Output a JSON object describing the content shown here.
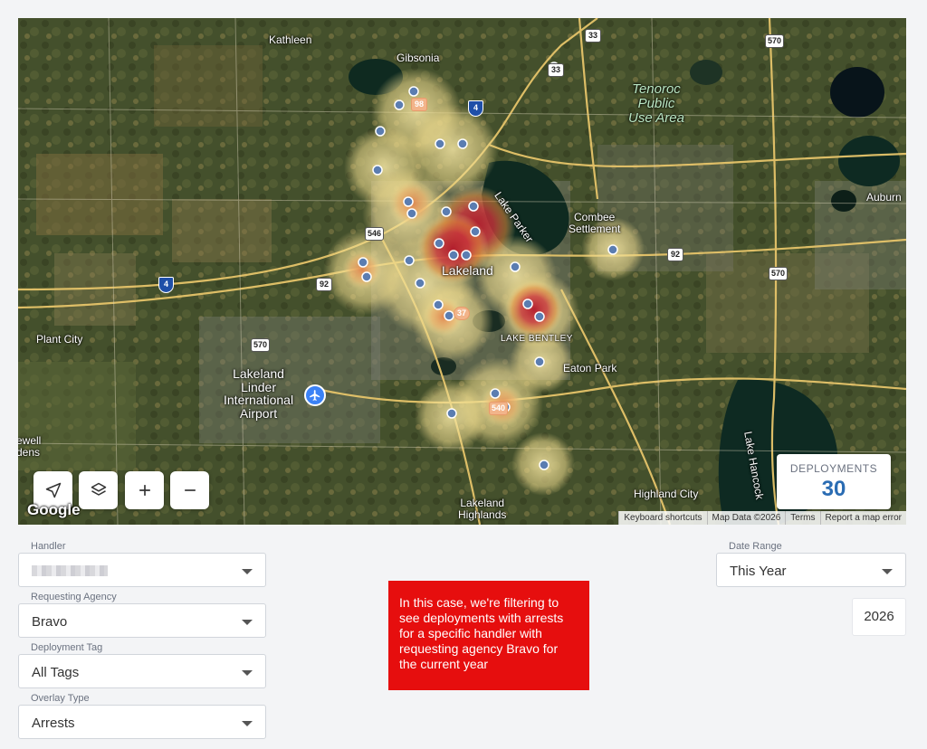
{
  "map": {
    "places": {
      "kathleen": "Kathleen",
      "gibsonia": "Gibsonia",
      "tenoroc": "Tenoroc\nPublic\nUse Area",
      "lake_parker": "Lake Parker",
      "combee": "Combee\nSettlement",
      "auburndale": "Auburn",
      "lakeland": "Lakeland",
      "lake_bentley": "LAKE BENTLEY",
      "eaton_park": "Eaton Park",
      "plant_city": "Plant City",
      "airport": "Lakeland\nLinder\nInternational\nAirport",
      "highland_city": "Highland City",
      "lakeland_highlands": "Lakeland\nHighlands",
      "lake_hancock": "Lake Hancock",
      "ewell": "ewell\ndens"
    },
    "route_shields": {
      "r33a": "33",
      "r33b": "33",
      "r570a": "570",
      "r570b": "570",
      "r570c": "570",
      "r546": "546",
      "r92a": "92",
      "r92b": "92",
      "r98": "98",
      "r37": "37",
      "r540": "540",
      "i4a": "4",
      "i4b": "4"
    },
    "google_logo": "Google",
    "attribution": [
      "Keyboard shortcuts",
      "Map Data ©2026",
      "Terms",
      "Report a map error"
    ],
    "controls": [
      {
        "name": "locate-button",
        "icon": "navigation-arrow-icon"
      },
      {
        "name": "layers-button",
        "icon": "layers-icon"
      },
      {
        "name": "zoom-in-button",
        "icon": "plus-icon"
      },
      {
        "name": "zoom-out-button",
        "icon": "minus-icon"
      }
    ],
    "overlay_type": "heatmap",
    "heat_colors": {
      "low": "#f0e29a",
      "mid": "#e48a3c",
      "high": "#b2182b"
    },
    "marker_color": "#5b7db1"
  },
  "deployments": {
    "label": "DEPLOYMENTS",
    "count": "30",
    "color": "#2a6cb3"
  },
  "filters": {
    "handler": {
      "label": "Handler",
      "value": ""
    },
    "requesting_agency": {
      "label": "Requesting Agency",
      "value": "Bravo"
    },
    "deployment_tag": {
      "label": "Deployment Tag",
      "value": "All Tags"
    },
    "overlay_type": {
      "label": "Overlay Type",
      "value": "Arrests"
    },
    "date_range": {
      "label": "Date Range",
      "value": "This Year"
    },
    "year": "2026"
  },
  "note": {
    "text": "In this case, we're filtering to see deployments with arrests for a specific handler with requesting agency Bravo for the current year",
    "color": "#e60e0e"
  }
}
